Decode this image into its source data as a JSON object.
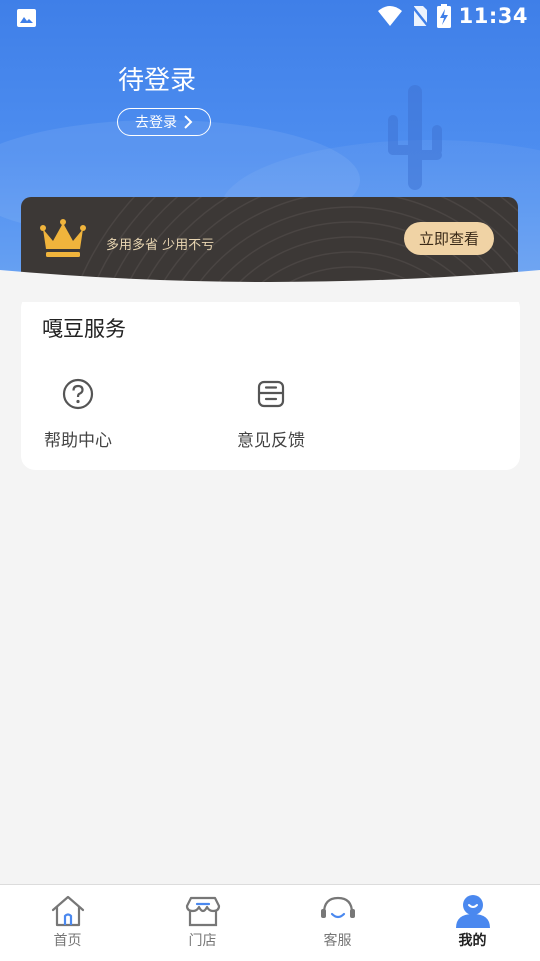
{
  "status_bar": {
    "time": "11:34"
  },
  "header": {
    "title": "待登录",
    "login_button": "去登录"
  },
  "vip_banner": {
    "slogan": "多用多省 少用不亏",
    "view_button": "立即查看"
  },
  "services": {
    "title": "嘎豆服务",
    "items": [
      {
        "label": "帮助中心",
        "icon": "question-circle-icon"
      },
      {
        "label": "意见反馈",
        "icon": "feedback-box-icon"
      }
    ]
  },
  "bottom_nav": {
    "items": [
      {
        "label": "首页",
        "icon": "home-icon"
      },
      {
        "label": "门店",
        "icon": "store-icon"
      },
      {
        "label": "客服",
        "icon": "headset-icon"
      },
      {
        "label": "我的",
        "icon": "user-icon",
        "active": true
      }
    ]
  },
  "colors": {
    "brand_blue": "#4a88ef",
    "vip_dark": "#3c3836",
    "vip_gold": "#f0d3a5",
    "crown_gold": "#f0b43c"
  }
}
